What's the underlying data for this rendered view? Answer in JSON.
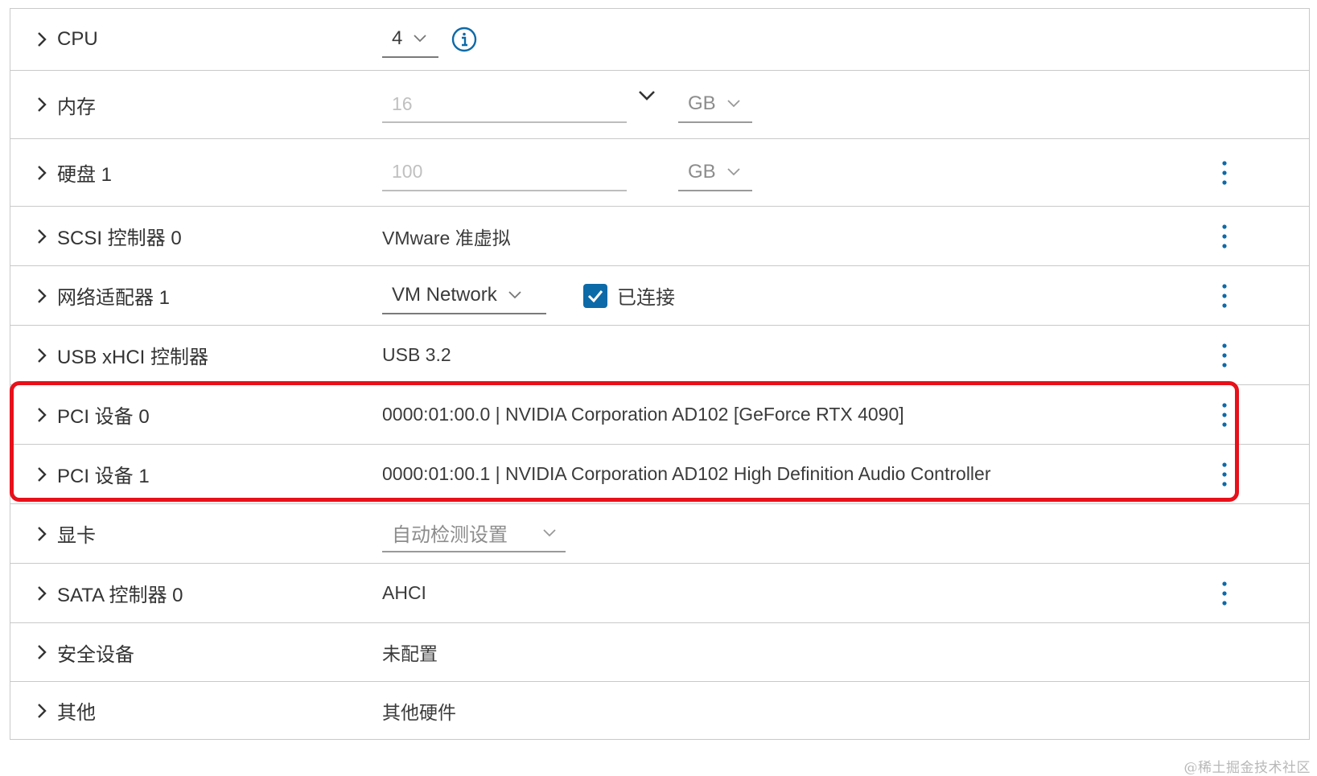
{
  "rows": {
    "cpu": {
      "label": "CPU",
      "value": "4"
    },
    "memory": {
      "label": "内存",
      "placeholder": "16",
      "unit": "GB"
    },
    "disk": {
      "label": "硬盘 1",
      "placeholder": "100",
      "unit": "GB"
    },
    "scsi": {
      "label": "SCSI 控制器 0",
      "value": "VMware 准虚拟"
    },
    "network": {
      "label": "网络适配器 1",
      "value": "VM Network",
      "connected_label": "已连接",
      "connected": true
    },
    "usb": {
      "label": "USB xHCI 控制器",
      "value": "USB 3.2"
    },
    "pci0": {
      "label": "PCI 设备 0",
      "value": "0000:01:00.0 | NVIDIA Corporation AD102 [GeForce RTX 4090]"
    },
    "pci1": {
      "label": "PCI 设备 1",
      "value": "0000:01:00.1 | NVIDIA Corporation AD102 High Definition Audio Controller"
    },
    "video": {
      "label": "显卡",
      "value": "自动检测设置"
    },
    "sata": {
      "label": "SATA 控制器 0",
      "value": "AHCI"
    },
    "security": {
      "label": "安全设备",
      "value": "未配置"
    },
    "other": {
      "label": "其他",
      "value": "其他硬件"
    }
  },
  "watermark": "@稀土掘金技术社区",
  "colors": {
    "accent": "#0d6aa8",
    "highlight": "#e8101a",
    "border": "#c9c9c9"
  },
  "icons": {
    "expand": "chevron-right-icon",
    "info": "info-icon",
    "more": "kebab-icon",
    "dropdown": "chevron-down-icon"
  }
}
